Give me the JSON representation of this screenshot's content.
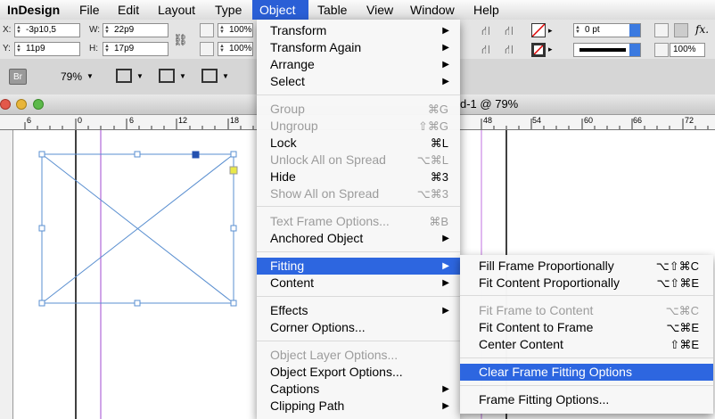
{
  "menubar": {
    "app": "InDesign",
    "items": [
      "File",
      "Edit",
      "Layout",
      "Type",
      "Object",
      "Table",
      "View",
      "Window",
      "Help"
    ]
  },
  "control": {
    "x_label": "X:",
    "x_value": "-3p10,5",
    "y_label": "Y:",
    "y_value": "11p9",
    "w_label": "W:",
    "w_value": "22p9",
    "h_label": "H:",
    "h_value": "17p9",
    "scale_x": "100%",
    "scale_y": "100%",
    "stroke_weight": "0 pt",
    "right_percent": "100%",
    "fx_label": "fx."
  },
  "app_bar": {
    "bridge_label": "Br",
    "zoom": "79%"
  },
  "document": {
    "title": "d-1 @ 79%",
    "ruler_labels": [
      "6",
      "0",
      "6",
      "12",
      "18",
      "48",
      "54",
      "60",
      "66",
      "72"
    ]
  },
  "object_menu": {
    "items": [
      {
        "label": "Transform",
        "submenu": true
      },
      {
        "label": "Transform Again",
        "submenu": true
      },
      {
        "label": "Arrange",
        "submenu": true
      },
      {
        "label": "Select",
        "submenu": true
      },
      {
        "label": "Group",
        "shortcut": "⌘G",
        "disabled": true
      },
      {
        "label": "Ungroup",
        "shortcut": "⇧⌘G",
        "disabled": true
      },
      {
        "label": "Lock",
        "shortcut": "⌘L"
      },
      {
        "label": "Unlock All on Spread",
        "shortcut": "⌥⌘L",
        "disabled": true
      },
      {
        "label": "Hide",
        "shortcut": "⌘3"
      },
      {
        "label": "Show All on Spread",
        "shortcut": "⌥⌘3",
        "disabled": true
      },
      {
        "label": "Text Frame Options...",
        "shortcut": "⌘B",
        "disabled": true
      },
      {
        "label": "Anchored Object",
        "submenu": true
      },
      {
        "label": "Fitting",
        "submenu": true,
        "highlighted": true
      },
      {
        "label": "Content",
        "submenu": true
      },
      {
        "label": "Effects",
        "submenu": true
      },
      {
        "label": "Corner Options..."
      },
      {
        "label": "Object Layer Options...",
        "disabled": true
      },
      {
        "label": "Object Export Options..."
      },
      {
        "label": "Captions",
        "submenu": true
      },
      {
        "label": "Clipping Path",
        "submenu": true
      }
    ]
  },
  "fitting_submenu": {
    "items": [
      {
        "label": "Fill Frame Proportionally",
        "shortcut": "⌥⇧⌘C"
      },
      {
        "label": "Fit Content Proportionally",
        "shortcut": "⌥⇧⌘E"
      },
      {
        "label": "Fit Frame to Content",
        "shortcut": "⌥⌘C",
        "disabled": true
      },
      {
        "label": "Fit Content to Frame",
        "shortcut": "⌥⌘E"
      },
      {
        "label": "Center Content",
        "shortcut": "⇧⌘E"
      },
      {
        "label": "Clear Frame Fitting Options",
        "highlighted": true
      },
      {
        "label": "Frame Fitting Options..."
      }
    ]
  },
  "colors": {
    "menu_highlight": "#2d66e0",
    "active_menubar": "#2a5fd6",
    "frame_stroke": "#5a8fd0",
    "guide_purple": "#a04ad0"
  }
}
